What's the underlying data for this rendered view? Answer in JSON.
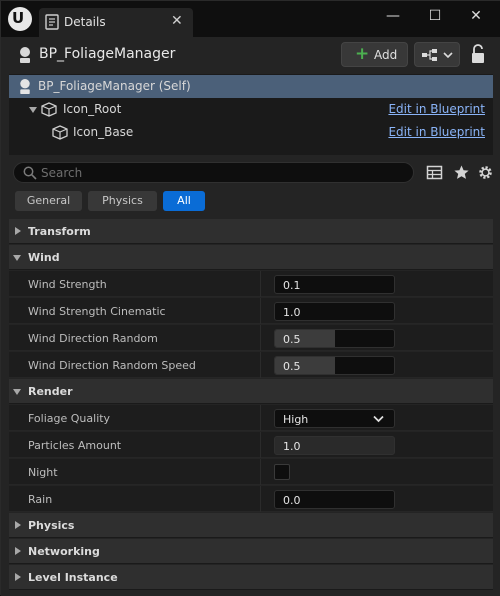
{
  "window": {
    "tab_label": "Details",
    "close_glyph": "✕",
    "minimize_glyph": "—",
    "maximize_glyph": "☐",
    "close_window_glyph": "✕"
  },
  "header": {
    "object_name": "BP_FoliageManager",
    "add_label": "Add",
    "add_plus": "+"
  },
  "tree": [
    {
      "label": "BP_FoliageManager (Self)",
      "link": ""
    },
    {
      "label": "Icon_Root",
      "link": "Edit in Blueprint"
    },
    {
      "label": "Icon_Base",
      "link": "Edit in Blueprint"
    }
  ],
  "search": {
    "placeholder": "Search"
  },
  "filters": [
    "General",
    "Physics",
    "All"
  ],
  "active_filter": "All",
  "sections": {
    "transform": "Transform",
    "wind": "Wind",
    "render": "Render",
    "physics": "Physics",
    "networking": "Networking",
    "level_instance": "Level Instance"
  },
  "wind": [
    {
      "label": "Wind Strength",
      "value": "0.1",
      "fill": 0.0
    },
    {
      "label": "Wind Strength Cinematic",
      "value": "1.0",
      "fill": 0.0
    },
    {
      "label": "Wind Direction Random",
      "value": "0.5",
      "fill": 0.5
    },
    {
      "label": "Wind Direction Random Speed",
      "value": "0.5",
      "fill": 0.5
    }
  ],
  "render": {
    "foliage_quality": {
      "label": "Foliage Quality",
      "value": "High"
    },
    "particles_amount": {
      "label": "Particles Amount",
      "value": "1.0"
    },
    "night": {
      "label": "Night",
      "checked": false
    },
    "rain": {
      "label": "Rain",
      "value": "0.0"
    }
  },
  "colors": {
    "accent": "#0a6cd6",
    "selection": "#4b6079",
    "link": "#8ab4f8",
    "add_plus": "#4caf50"
  }
}
